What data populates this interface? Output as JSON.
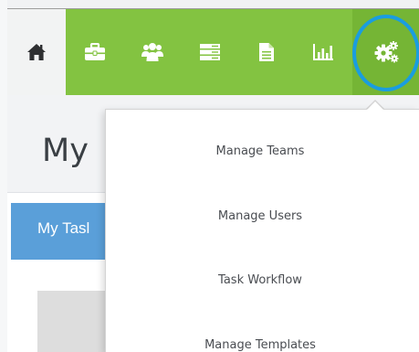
{
  "navbar": {
    "items": [
      {
        "icon": "home-icon",
        "active": true
      },
      {
        "icon": "briefcase-icon",
        "active": false
      },
      {
        "icon": "team-icon",
        "active": false
      },
      {
        "icon": "server-icon",
        "active": false
      },
      {
        "icon": "document-icon",
        "active": false
      },
      {
        "icon": "bar-chart-icon",
        "active": false
      },
      {
        "icon": "gears-icon",
        "active": false
      }
    ],
    "colors": {
      "bar": "#83c341",
      "active_item": "#f2f3f3",
      "settings_item": "#75b535",
      "highlight_ring": "#1a9de0"
    }
  },
  "page": {
    "title": "My",
    "tab_label": "My Tasl",
    "tab_color": "#5a9fd9"
  },
  "settings_menu": {
    "items": [
      {
        "label": "Manage Teams"
      },
      {
        "label": "Manage Users"
      },
      {
        "label": "Task Workflow"
      },
      {
        "label": "Manage Templates"
      }
    ]
  }
}
